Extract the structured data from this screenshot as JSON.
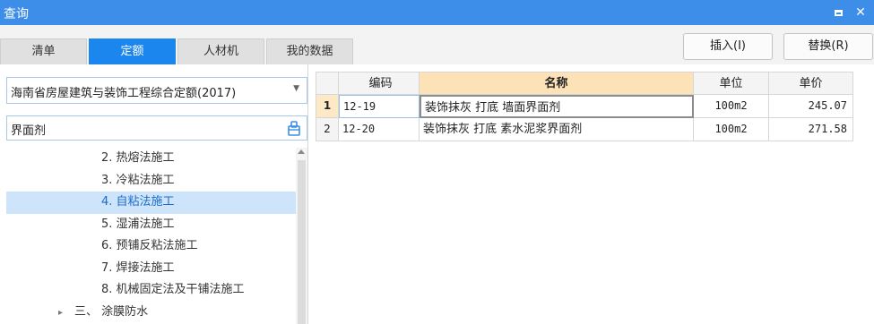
{
  "window": {
    "title": "查询",
    "maximize_icon": "maximize-icon",
    "close_icon": "close-icon",
    "close_glyph": "✕"
  },
  "tabs": [
    "清单",
    "定额",
    "人材机",
    "我的数据"
  ],
  "active_tab": "定额",
  "toolbar": {
    "insert_label": "插入(I)",
    "replace_label": "替换(R)"
  },
  "left": {
    "selected_dataset": "海南省房屋建筑与装饰工程综合定额(2017)",
    "search_value": "界面剂",
    "tree": [
      {
        "label": "2. 热熔法施工",
        "indent": 2,
        "selected": false,
        "expander": ""
      },
      {
        "label": "3. 冷粘法施工",
        "indent": 2,
        "selected": false,
        "expander": ""
      },
      {
        "label": "4. 自粘法施工",
        "indent": 2,
        "selected": true,
        "expander": ""
      },
      {
        "label": "5. 湿浦法施工",
        "indent": 2,
        "selected": false,
        "expander": ""
      },
      {
        "label": "6. 预铺反粘法施工",
        "indent": 2,
        "selected": false,
        "expander": ""
      },
      {
        "label": "7. 焊接法施工",
        "indent": 2,
        "selected": false,
        "expander": ""
      },
      {
        "label": "8. 机械固定法及干铺法施工",
        "indent": 2,
        "selected": false,
        "expander": ""
      },
      {
        "label": "三、 涂膜防水",
        "indent": 1,
        "selected": false,
        "expander": "▸"
      }
    ]
  },
  "table": {
    "headers": {
      "code": "编码",
      "name": "名称",
      "unit": "单位",
      "price": "单价"
    },
    "rows": [
      {
        "num": "1",
        "code": "12-19",
        "name": "装饰抹灰 打底 墙面界面剂",
        "unit": "100m2",
        "price": "245.07",
        "selected": true
      },
      {
        "num": "2",
        "code": "12-20",
        "name": "装饰抹灰 打底 素水泥浆界面剂",
        "unit": "100m2",
        "price": "271.58",
        "selected": false
      }
    ]
  },
  "colors": {
    "titlebar": "#3c8ee8",
    "active_tab": "#1c86ef",
    "selection": "#cde4fa",
    "name_header": "#fde2b8"
  }
}
